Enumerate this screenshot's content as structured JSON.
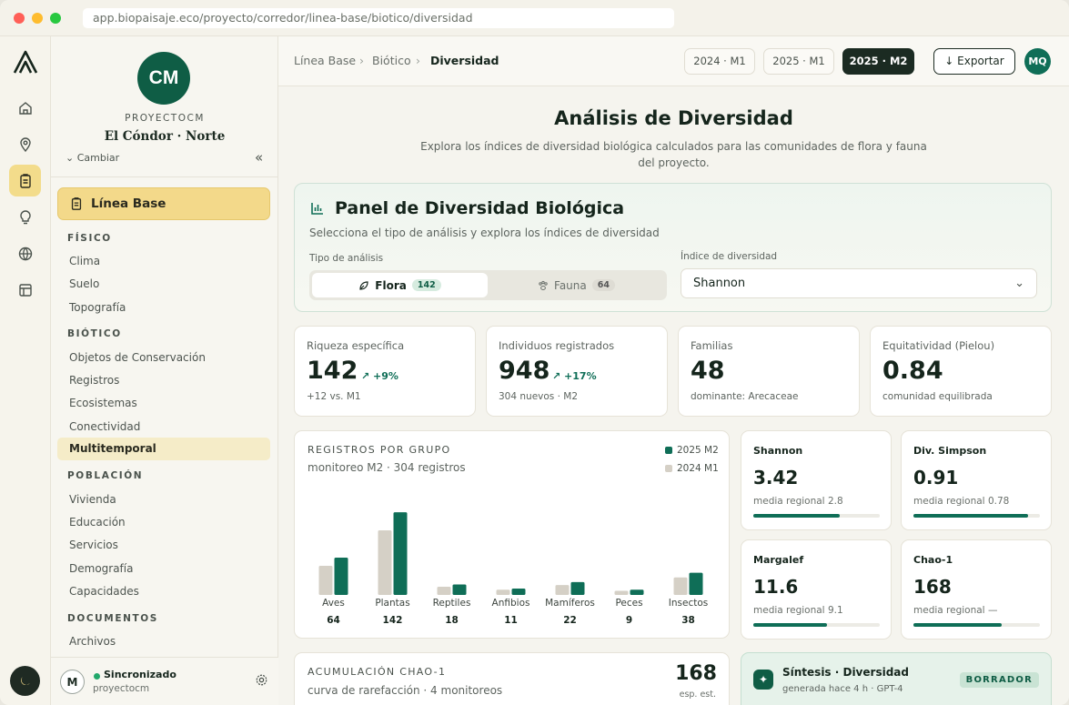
{
  "browser": {
    "url": "app.biopaisaje.eco/proyecto/corredor/linea-base/biotico/diversidad"
  },
  "colors": {
    "accent": "#0f6e57",
    "highlight": "#f3d98a",
    "dark": "#1b2b22",
    "series_prev": "#d5d0c6"
  },
  "rail": {
    "icons": [
      "logo-icon",
      "home-icon",
      "location-icon",
      "clipboard-icon",
      "lightbulb-icon",
      "globe-icon",
      "layout-icon",
      "moon-icon"
    ]
  },
  "sidebar": {
    "avatar": "CM",
    "project_code": "PROYECTOCM",
    "project_name": "El Cóndor · Norte",
    "change_label": "Cambiar",
    "collapse_label": "«",
    "main_section": "Línea Base",
    "groups": [
      {
        "title": "FÍSICO",
        "items": [
          "Clima",
          "Suelo",
          "Topografía"
        ]
      },
      {
        "title": "BIÓTICO",
        "items": [
          "Objetos de Conservación",
          "Registros",
          "Ecosistemas",
          "Conectividad",
          "Multitemporal"
        ]
      },
      {
        "title": "POBLACIÓN",
        "items": [
          "Vivienda",
          "Educación",
          "Servicios",
          "Demografía",
          "Capacidades"
        ]
      },
      {
        "title": "DOCUMENTOS",
        "items": [
          "Archivos"
        ]
      }
    ],
    "selected_item": "Multitemporal",
    "footer": {
      "avatar": "M",
      "status": "Sincronizado",
      "user": "proyectocm"
    }
  },
  "topbar": {
    "breadcrumb": [
      "Línea Base",
      "Biótico",
      "Diversidad"
    ],
    "periods": [
      "2024 · M1",
      "2025 · M1",
      "2025 · M2"
    ],
    "active_period": "2025 · M2",
    "export_label": "↓ Exportar",
    "user_initials": "MQ"
  },
  "page": {
    "title": "Análisis de Diversidad",
    "subtitle": "Explora los índices de diversidad biológica calculados para las comunidades de flora y fauna del proyecto."
  },
  "panel": {
    "title": "Panel de Diversidad Biológica",
    "subtitle": "Selecciona el tipo de análisis y explora los índices de diversidad",
    "type_label": "Tipo de análisis",
    "tabs": [
      {
        "label": "Flora",
        "count": "142"
      },
      {
        "label": "Fauna",
        "count": "64"
      }
    ],
    "index_label": "Índice de diversidad",
    "index_value": "Shannon"
  },
  "kpis": [
    {
      "title": "Riqueza específica",
      "value": "142",
      "delta": "↗ +9%",
      "note": "+12 vs. M1"
    },
    {
      "title": "Individuos registrados",
      "value": "948",
      "delta": "↗ +17%",
      "note": "304 nuevos · M2"
    },
    {
      "title": "Familias",
      "value": "48",
      "delta": "",
      "note": "dominante: Arecaceae"
    },
    {
      "title": "Equitatividad (Pielou)",
      "value": "0.84",
      "delta": "",
      "note": "comunidad equilibrada"
    }
  ],
  "chart_data": {
    "type": "bar",
    "title": "REGISTROS POR GRUPO",
    "subtitle": "monitoreo M2 · 304 registros",
    "categories": [
      "Aves",
      "Plantas",
      "Reptiles",
      "Anfibios",
      "Mamíferos",
      "Peces",
      "Insectos"
    ],
    "series": [
      {
        "name": "2025 M2",
        "values": [
          64,
          142,
          18,
          11,
          22,
          9,
          38
        ],
        "color": "#0f6e57"
      },
      {
        "name": "2024 M1",
        "values": [
          50,
          111,
          14,
          9,
          17,
          7,
          30
        ],
        "color": "#d5d0c6"
      }
    ],
    "data_labels": [
      "64",
      "142",
      "18",
      "11",
      "22",
      "9",
      "38"
    ],
    "ylim": [
      0,
      150
    ],
    "grid": false,
    "legend": "top-right"
  },
  "indices": [
    {
      "name": "Shannon",
      "value": "3.42",
      "note": "media regional 2.8",
      "level": 0.68
    },
    {
      "name": "Div. Simpson",
      "value": "0.91",
      "note": "media regional 0.78",
      "level": 0.91
    },
    {
      "name": "Margalef",
      "value": "11.6",
      "note": "media regional 9.1",
      "level": 0.58
    },
    {
      "name": "Chao-1",
      "value": "168",
      "note": "media regional —",
      "level": 0.7
    }
  ],
  "accumulation": {
    "title": "ACUMULACIÓN CHAO-1",
    "subtitle": "curva de rarefacción · 4 monitoreos",
    "value": "168",
    "unit": "esp. est."
  },
  "synthesis": {
    "title": "Síntesis · Diversidad",
    "subtitle": "generada hace 4 h · GPT-4",
    "badge": "BORRADOR"
  }
}
